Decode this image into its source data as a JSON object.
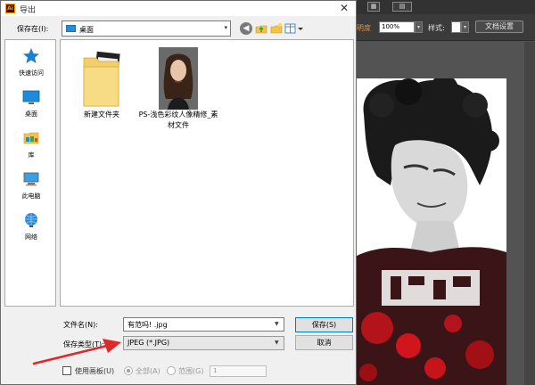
{
  "colors": {
    "accent_red": "#e0282a",
    "ai_orange": "#e0913a",
    "folder_blue": "#2a8ad4"
  },
  "illustrator": {
    "topbar_glyphs": [
      "▦",
      "▤"
    ],
    "left_fragment": "明度",
    "zoom_value": "100%",
    "style_label": "样式:",
    "doc_settings_label": "文档设置"
  },
  "dialog": {
    "app_icon": "Ai",
    "title": "导出",
    "close_glyph": "✕",
    "save_in_label": "保存在(I):",
    "save_in_value": "桌面",
    "toolbar_icons": [
      "back-icon",
      "up-folder-icon",
      "new-folder-icon",
      "view-menu-icon"
    ],
    "places": [
      {
        "label": "快速访问",
        "icon": "star-icon"
      },
      {
        "label": "桌面",
        "icon": "desktop-icon"
      },
      {
        "label": "库",
        "icon": "library-icon"
      },
      {
        "label": "此电脑",
        "icon": "computer-icon"
      },
      {
        "label": "网络",
        "icon": "network-icon"
      }
    ],
    "files": [
      {
        "name": "新建文件夹",
        "icon": "folder-icon"
      },
      {
        "name": "PS-浅色彩纹人像精修_素材文件",
        "icon": "image-thumbnail"
      }
    ],
    "filename_label": "文件名(N):",
    "filename_value": "有范吗! .jpg",
    "filetype_label": "保存类型(T):",
    "filetype_value": "JPEG (*.JPG)",
    "save_button": "保存(S)",
    "cancel_button": "取消",
    "use_artboards": "使用画板(U)",
    "all_option": "全部(A)",
    "range_option": "范围(G)",
    "range_value": "1"
  }
}
